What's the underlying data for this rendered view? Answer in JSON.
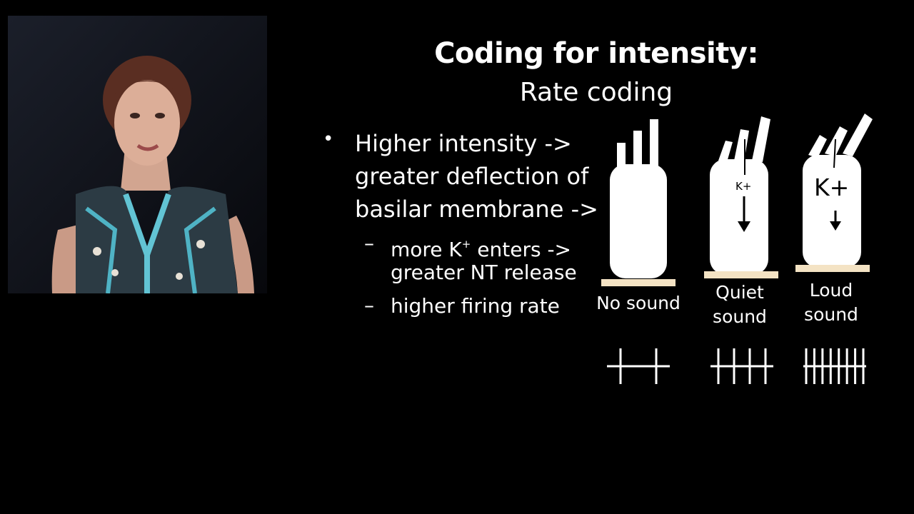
{
  "slide": {
    "title": "Coding for intensity:",
    "subtitle": "Rate coding",
    "bullet": {
      "lines": [
        "Higher intensity ->",
        "greater deflection of",
        "basilar membrane ->"
      ]
    },
    "subbullets": [
      {
        "dash": "–",
        "line1_pre": "more K",
        "line1_sup": "+",
        "line1_post": " enters ->",
        "line2": "greater NT release"
      },
      {
        "dash": "–",
        "line1": "higher firing rate"
      }
    ],
    "diagram": {
      "conditions": [
        {
          "label_lines": [
            "No sound"
          ],
          "ion_label": "",
          "spikes": 2
        },
        {
          "label_lines": [
            "Quiet",
            "sound"
          ],
          "ion_label": "K+",
          "spikes": 4
        },
        {
          "label_lines": [
            "Loud",
            "sound"
          ],
          "ion_label": "K+",
          "spikes": 8
        }
      ],
      "colors": {
        "cell": "#ffffff",
        "base": "#f4e3c4",
        "background": "#000000"
      }
    },
    "video": {
      "icon": "speaker-video"
    }
  }
}
